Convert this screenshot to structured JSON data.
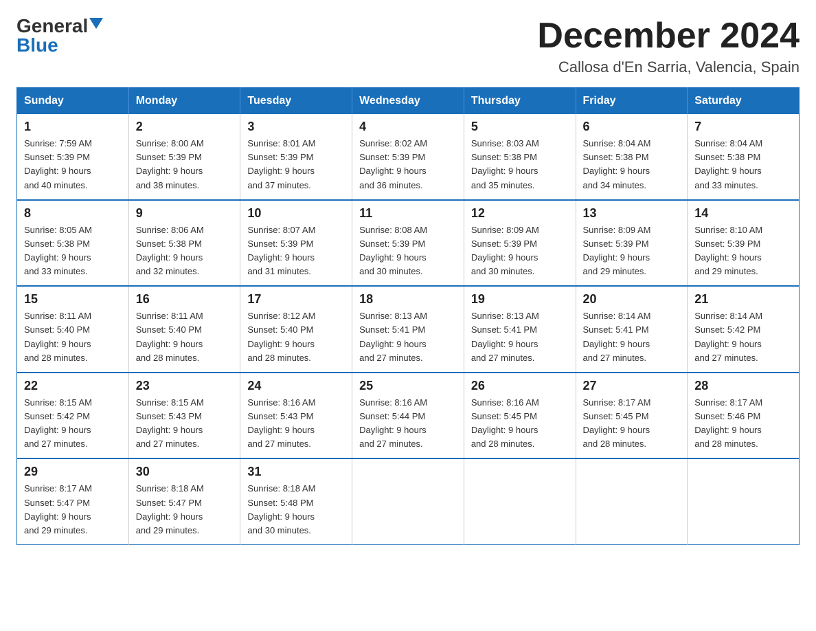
{
  "logo": {
    "general": "General",
    "blue": "Blue"
  },
  "title": "December 2024",
  "location": "Callosa d'En Sarria, Valencia, Spain",
  "days_of_week": [
    "Sunday",
    "Monday",
    "Tuesday",
    "Wednesday",
    "Thursday",
    "Friday",
    "Saturday"
  ],
  "weeks": [
    [
      {
        "day": "1",
        "sunrise": "7:59 AM",
        "sunset": "5:39 PM",
        "daylight": "9 hours and 40 minutes."
      },
      {
        "day": "2",
        "sunrise": "8:00 AM",
        "sunset": "5:39 PM",
        "daylight": "9 hours and 38 minutes."
      },
      {
        "day": "3",
        "sunrise": "8:01 AM",
        "sunset": "5:39 PM",
        "daylight": "9 hours and 37 minutes."
      },
      {
        "day": "4",
        "sunrise": "8:02 AM",
        "sunset": "5:39 PM",
        "daylight": "9 hours and 36 minutes."
      },
      {
        "day": "5",
        "sunrise": "8:03 AM",
        "sunset": "5:38 PM",
        "daylight": "9 hours and 35 minutes."
      },
      {
        "day": "6",
        "sunrise": "8:04 AM",
        "sunset": "5:38 PM",
        "daylight": "9 hours and 34 minutes."
      },
      {
        "day": "7",
        "sunrise": "8:04 AM",
        "sunset": "5:38 PM",
        "daylight": "9 hours and 33 minutes."
      }
    ],
    [
      {
        "day": "8",
        "sunrise": "8:05 AM",
        "sunset": "5:38 PM",
        "daylight": "9 hours and 33 minutes."
      },
      {
        "day": "9",
        "sunrise": "8:06 AM",
        "sunset": "5:38 PM",
        "daylight": "9 hours and 32 minutes."
      },
      {
        "day": "10",
        "sunrise": "8:07 AM",
        "sunset": "5:39 PM",
        "daylight": "9 hours and 31 minutes."
      },
      {
        "day": "11",
        "sunrise": "8:08 AM",
        "sunset": "5:39 PM",
        "daylight": "9 hours and 30 minutes."
      },
      {
        "day": "12",
        "sunrise": "8:09 AM",
        "sunset": "5:39 PM",
        "daylight": "9 hours and 30 minutes."
      },
      {
        "day": "13",
        "sunrise": "8:09 AM",
        "sunset": "5:39 PM",
        "daylight": "9 hours and 29 minutes."
      },
      {
        "day": "14",
        "sunrise": "8:10 AM",
        "sunset": "5:39 PM",
        "daylight": "9 hours and 29 minutes."
      }
    ],
    [
      {
        "day": "15",
        "sunrise": "8:11 AM",
        "sunset": "5:40 PM",
        "daylight": "9 hours and 28 minutes."
      },
      {
        "day": "16",
        "sunrise": "8:11 AM",
        "sunset": "5:40 PM",
        "daylight": "9 hours and 28 minutes."
      },
      {
        "day": "17",
        "sunrise": "8:12 AM",
        "sunset": "5:40 PM",
        "daylight": "9 hours and 28 minutes."
      },
      {
        "day": "18",
        "sunrise": "8:13 AM",
        "sunset": "5:41 PM",
        "daylight": "9 hours and 27 minutes."
      },
      {
        "day": "19",
        "sunrise": "8:13 AM",
        "sunset": "5:41 PM",
        "daylight": "9 hours and 27 minutes."
      },
      {
        "day": "20",
        "sunrise": "8:14 AM",
        "sunset": "5:41 PM",
        "daylight": "9 hours and 27 minutes."
      },
      {
        "day": "21",
        "sunrise": "8:14 AM",
        "sunset": "5:42 PM",
        "daylight": "9 hours and 27 minutes."
      }
    ],
    [
      {
        "day": "22",
        "sunrise": "8:15 AM",
        "sunset": "5:42 PM",
        "daylight": "9 hours and 27 minutes."
      },
      {
        "day": "23",
        "sunrise": "8:15 AM",
        "sunset": "5:43 PM",
        "daylight": "9 hours and 27 minutes."
      },
      {
        "day": "24",
        "sunrise": "8:16 AM",
        "sunset": "5:43 PM",
        "daylight": "9 hours and 27 minutes."
      },
      {
        "day": "25",
        "sunrise": "8:16 AM",
        "sunset": "5:44 PM",
        "daylight": "9 hours and 27 minutes."
      },
      {
        "day": "26",
        "sunrise": "8:16 AM",
        "sunset": "5:45 PM",
        "daylight": "9 hours and 28 minutes."
      },
      {
        "day": "27",
        "sunrise": "8:17 AM",
        "sunset": "5:45 PM",
        "daylight": "9 hours and 28 minutes."
      },
      {
        "day": "28",
        "sunrise": "8:17 AM",
        "sunset": "5:46 PM",
        "daylight": "9 hours and 28 minutes."
      }
    ],
    [
      {
        "day": "29",
        "sunrise": "8:17 AM",
        "sunset": "5:47 PM",
        "daylight": "9 hours and 29 minutes."
      },
      {
        "day": "30",
        "sunrise": "8:18 AM",
        "sunset": "5:47 PM",
        "daylight": "9 hours and 29 minutes."
      },
      {
        "day": "31",
        "sunrise": "8:18 AM",
        "sunset": "5:48 PM",
        "daylight": "9 hours and 30 minutes."
      },
      null,
      null,
      null,
      null
    ]
  ]
}
